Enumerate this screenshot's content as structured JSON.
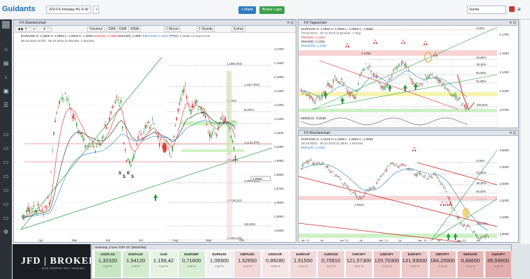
{
  "app": {
    "logo": "Guidants",
    "logo_sup": "v1"
  },
  "tabs": [
    "JFD-FX-Intraday-H1-D-W",
    "+"
  ],
  "buttons": {
    "markt": "+ Markt",
    "broker": "Broker Login"
  },
  "search_placeholder": "Suche",
  "left_panel": {
    "title": "FX-Stundenchart",
    "toolbar": [
      "Volumen",
      "SMA",
      "EMA",
      "WMA",
      "1 Monat",
      "1 Stunde",
      "Extras"
    ],
    "legend1": "EUR/USD   O: 1,0926  H: 1,0934  L: 1,0915  C: 1,0928",
    "legend1b": "EMA(20): 1,0955",
    "legend1c": "EMA(50): 1,0997",
    "legend1d": "EMA(100): 1,1047",
    "legend1e": "PP(W): 1,1133",
    "legend1f": "Vortageswerte",
    "legend2": "06.03.2015 20:00 - 09.10.2015 (6 Monate, 1 Stunde)",
    "price_axis": [
      "1,1700",
      "1,1600",
      "1,1500",
      "1,1400",
      "1,1300",
      "1,1200",
      "1,1100",
      "1,1000",
      "1,0900",
      "1,0800",
      "1,0700",
      "1,0600",
      "1,0500",
      "1,0400"
    ],
    "date_axis": [
      "Apr",
      "Mai",
      "Jun",
      "Jul",
      "Aug",
      "Sep",
      "Okt"
    ],
    "fib_labels": [
      "1,1666 (R3)",
      "1,1527 (R2)",
      "38,20%",
      "50,00%",
      "61,80%",
      "1,1133 (PP)",
      "100,00%",
      "1,0876 (S1)",
      "1,0738 (S2)",
      "161,80%",
      "1,0484 (S3)"
    ],
    "current_price": "1,0928",
    "ssk": [
      "S",
      "S",
      "K",
      "S"
    ]
  },
  "right_top_panel": {
    "title": "FX-Tageschart",
    "legend1": "EUR/USD   O: 1,0933  H: 1,0945  L: 1,0902  C: 1,0930",
    "legend2": "29.04.2015 - 29.10.2015 (6 Monate, 1 Tag)",
    "legend3": "EMA(20): 1,1162",
    "legend4": "EMA(50): 1,1201",
    "legend5": "EMA(200): 1,1291",
    "mom": "MOM(14): -0,0452",
    "price_axis": [
      "1,1750",
      "1,1500",
      "1,1250",
      "1,1000",
      "1,0750"
    ],
    "fib": [
      "0,00%",
      "23,60%",
      "38,20%",
      "50,00%",
      "61,80%",
      "100,00%"
    ],
    "dates": [
      "Mai",
      "Jun",
      "Jul",
      "Aug",
      "Sep",
      "Okt"
    ],
    "label_1455": "1,1455"
  },
  "right_bottom_panel": {
    "title": "FX-Wochenchart",
    "legend1": "EUR/USD   O: 1,1019  H: 1,1096  L: 1,0894  C: 1,0930",
    "legend2": "25.10.2010 - 26.10.2015 (5 Jahre, 1 Woche)",
    "legend3": "EMA(20): 1,1160",
    "price_axis": [
      "1,5000",
      "1,4000",
      "1,3000",
      "1,2000",
      "1,1000",
      "1,0000"
    ],
    "fib": [
      "0,00%",
      "23,60%",
      "38,20%",
      "50,00%",
      "61,80%",
      "100,00%"
    ],
    "dates": [
      "Jan '11",
      "Jul",
      "Jan '12",
      "Jul",
      "Jan '13",
      "Jul",
      "Jan '14",
      "Jul",
      "Jan '15",
      "Jul"
    ],
    "label_1043": "1,0443"
  },
  "broker": {
    "name": "JFD | BROKERS",
    "tagline": "DIVE DEEPER INTO TRADING"
  },
  "watchlist": {
    "title": "Heatmap „Forex-TOP-15\" (Watchlist)",
    "items": [
      {
        "sym": "USD/CAD",
        "val": "1,32320",
        "pct": "0,35 %"
      },
      {
        "sym": "EUR/AUD",
        "val": "1,54120",
        "pct": "0,28 %"
      },
      {
        "sym": "Gold",
        "val": "1.159,42",
        "pct": "0,04 %"
      },
      {
        "sym": "EUR/GBP",
        "val": "0,71600",
        "pct": "0,34 %"
      },
      {
        "sym": "EUR/USD",
        "val": "1,09300",
        "pct": "0,00 %"
      },
      {
        "sym": "GBP/USD",
        "val": "1,52650",
        "pct": "-0,34 %"
      },
      {
        "sym": "USD/CHF",
        "val": "0,99280",
        "pct": "-0,06 %"
      },
      {
        "sym": "EUR/CHF",
        "val": "1,51550",
        "pct": "-0,10 %"
      },
      {
        "sym": "AUD/USD",
        "val": "0,70910",
        "pct": "-0,21 %"
      },
      {
        "sym": "CHF/JPY",
        "val": "121,57300",
        "pct": "-0,20 %"
      },
      {
        "sym": "USD/JPY",
        "val": "120,70300",
        "pct": "-0,29 %"
      },
      {
        "sym": "EUR/JPY",
        "val": "131,93000",
        "pct": "-0,29 %"
      },
      {
        "sym": "GBP/JPY",
        "val": "184,25900",
        "pct": "-0,35 %"
      },
      {
        "sym": "NZD/USD",
        "val": "0,66600",
        "pct": "-0,43 %"
      },
      {
        "sym": "AUD/JPY",
        "val": "85,59500",
        "pct": "-0,52 %"
      }
    ]
  },
  "colors": {
    "bull": "#2a9d3c",
    "bear": "#d42c2c",
    "accent": "#1d6fb8"
  }
}
